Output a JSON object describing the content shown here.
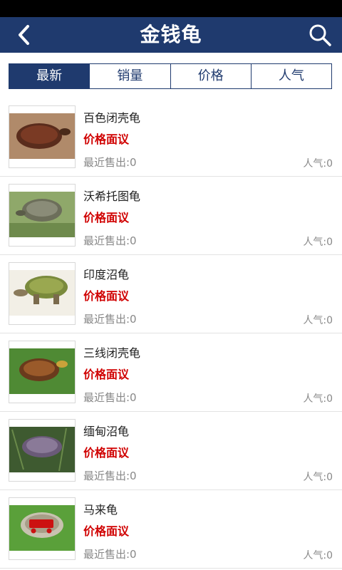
{
  "header": {
    "title": "金钱龟",
    "back_icon": "back-arrow-icon",
    "search_icon": "search-icon"
  },
  "tabs": [
    {
      "label": "最新",
      "active": true
    },
    {
      "label": "销量",
      "active": false
    },
    {
      "label": "价格",
      "active": false
    },
    {
      "label": "人气",
      "active": false
    }
  ],
  "items": [
    {
      "name": "百色闭壳龟",
      "price": "价格面议",
      "sold": "最近售出:0",
      "popularity": "人气:0"
    },
    {
      "name": "沃希托图龟",
      "price": "价格面议",
      "sold": "最近售出:0",
      "popularity": "人气:0"
    },
    {
      "name": "印度沼龟",
      "price": "价格面议",
      "sold": "最近售出:0",
      "popularity": "人气:0"
    },
    {
      "name": "三线闭壳龟",
      "price": "价格面议",
      "sold": "最近售出:0",
      "popularity": "人气:0"
    },
    {
      "name": "缅甸沼龟",
      "price": "价格面议",
      "sold": "最近售出:0",
      "popularity": "人气:0"
    },
    {
      "name": "马来龟",
      "price": "价格面议",
      "sold": "最近售出:0",
      "popularity": "人气:0"
    }
  ]
}
